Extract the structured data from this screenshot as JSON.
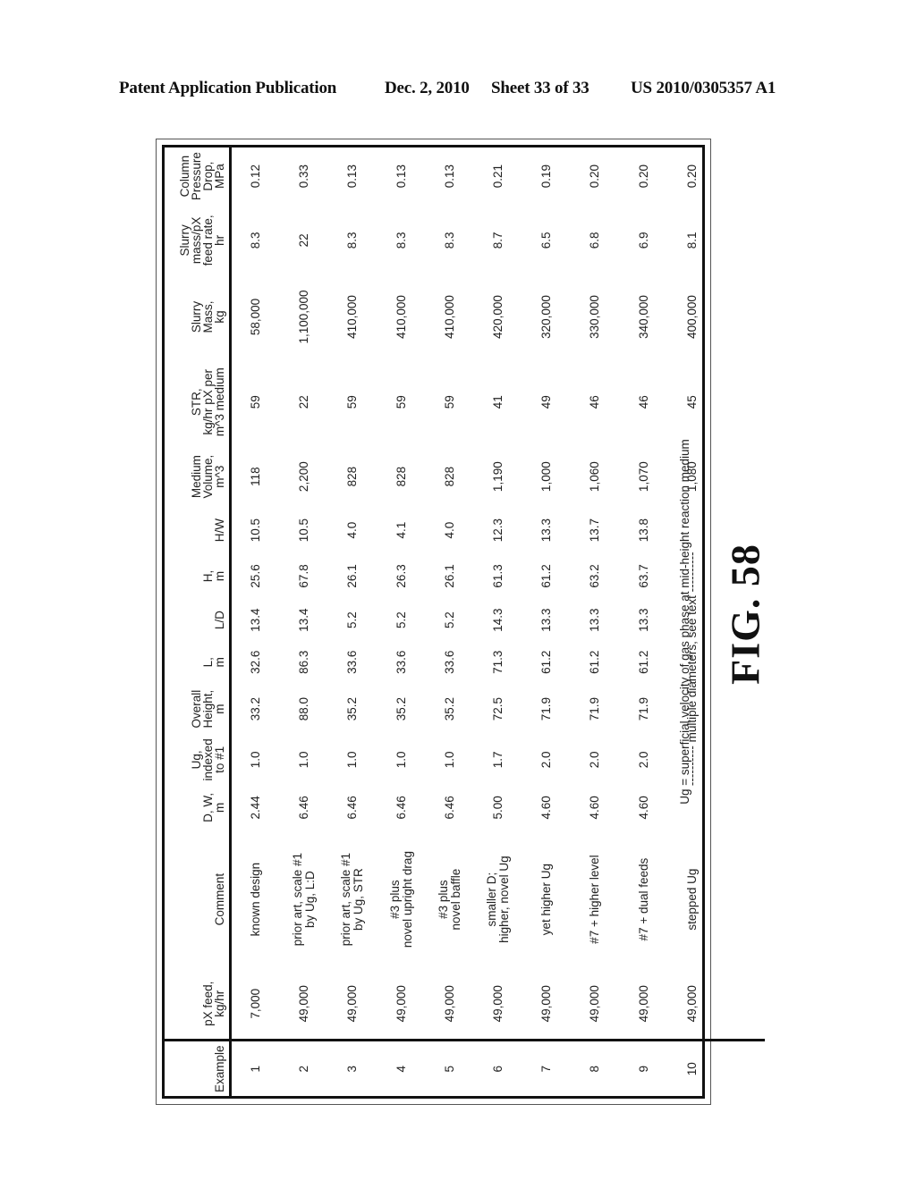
{
  "header": {
    "publication": "Patent Application Publication",
    "date": "Dec. 2, 2010",
    "sheet": "Sheet 33 of 33",
    "number": "US 2010/0305357 A1"
  },
  "figure_label": "FIG. 58",
  "table": {
    "columns": [
      "Example",
      "pX feed,\nkg/hr",
      "Comment",
      "D, W,\nm",
      "Ug,\nindexed\nto #1",
      "Overall\nHeight,\nm",
      "L,\nm",
      "L/D",
      "H,\nm",
      "H/W",
      "Medium\nVolume,\nm^3",
      "STR,\nkg/hr pX per\nm^3 medium",
      "Slurry\nMass,\nkg",
      "Slurry\nmass/pX\nfeed rate,\nhr",
      "Column\nPressure\nDrop,\nMPa"
    ],
    "rows": [
      [
        "1",
        "7,000",
        "known design",
        "2.44",
        "1.0",
        "33.2",
        "32.6",
        "13.4",
        "25.6",
        "10.5",
        "118",
        "59",
        "58,000",
        "8.3",
        "0.12"
      ],
      [
        "2",
        "49,000",
        "prior art, scale #1\nby Ug, L:D",
        "6.46",
        "1.0",
        "88.0",
        "86.3",
        "13.4",
        "67.8",
        "10.5",
        "2,200",
        "22",
        "1,100,000",
        "22",
        "0.33"
      ],
      [
        "3",
        "49,000",
        "prior art, scale #1\nby Ug, STR",
        "6.46",
        "1.0",
        "35.2",
        "33.6",
        "5.2",
        "26.1",
        "4.0",
        "828",
        "59",
        "410,000",
        "8.3",
        "0.13"
      ],
      [
        "4",
        "49,000",
        "#3 plus\nnovel upright drag",
        "6.46",
        "1.0",
        "35.2",
        "33.6",
        "5.2",
        "26.3",
        "4.1",
        "828",
        "59",
        "410,000",
        "8.3",
        "0.13"
      ],
      [
        "5",
        "49,000",
        "#3 plus\nnovel baffle",
        "6.46",
        "1.0",
        "35.2",
        "33.6",
        "5.2",
        "26.1",
        "4.0",
        "828",
        "59",
        "410,000",
        "8.3",
        "0.13"
      ],
      [
        "6",
        "49,000",
        "smaller D;\nhigher, novel Ug",
        "5.00",
        "1.7",
        "72.5",
        "71.3",
        "14.3",
        "61.3",
        "12.3",
        "1,190",
        "41",
        "420,000",
        "8.7",
        "0.21"
      ],
      [
        "7",
        "49,000",
        "yet higher Ug",
        "4.60",
        "2.0",
        "71.9",
        "61.2",
        "13.3",
        "61.2",
        "13.3",
        "1,000",
        "49",
        "320,000",
        "6.5",
        "0.19"
      ],
      [
        "8",
        "49,000",
        "#7 + higher level",
        "4.60",
        "2.0",
        "71.9",
        "61.2",
        "13.3",
        "63.2",
        "13.7",
        "1,060",
        "46",
        "330,000",
        "6.8",
        "0.20"
      ],
      [
        "9",
        "49,000",
        "#7 + dual feeds",
        "4.60",
        "2.0",
        "71.9",
        "61.2",
        "13.3",
        "63.7",
        "13.8",
        "1,070",
        "46",
        "340,000",
        "6.9",
        "0.20"
      ]
    ],
    "row10": {
      "example": "10",
      "px_feed": "49,000",
      "comment": "stepped Ug",
      "span_note": "---------- multiple diameters, see text ----------",
      "medium_volume": "1,080",
      "str": "45",
      "slurry_mass": "400,000",
      "slurry_ratio": "8.1",
      "pressure_drop": "0.20"
    },
    "footnote": "Ug = superficial velocity of gas phase at mid-height reaction medium"
  }
}
